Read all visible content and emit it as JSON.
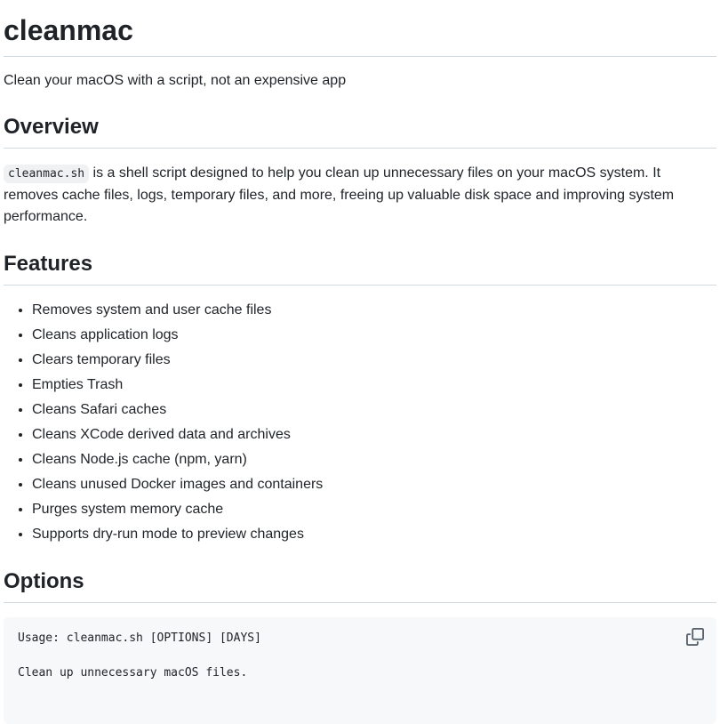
{
  "title": "cleanmac",
  "tagline": "Clean your macOS with a script, not an expensive app",
  "overview": {
    "heading": "Overview",
    "code": "cleanmac.sh",
    "text": " is a shell script designed to help you clean up unnecessary files on your macOS system. It removes cache files, logs, temporary files, and more, freeing up valuable disk space and improving system performance."
  },
  "features": {
    "heading": "Features",
    "items": [
      "Removes system and user cache files",
      "Cleans application logs",
      "Clears temporary files",
      "Empties Trash",
      "Cleans Safari caches",
      "Cleans XCode derived data and archives",
      "Cleans Node.js cache (npm, yarn)",
      "Cleans unused Docker images and containers",
      "Purges system memory cache",
      "Supports dry-run mode to preview changes"
    ]
  },
  "options": {
    "heading": "Options",
    "code_lines": [
      "Usage: cleanmac.sh [OPTIONS] [DAYS]",
      "",
      "Clean up unnecessary macOS files."
    ],
    "copy_icon": "copy-icon"
  }
}
